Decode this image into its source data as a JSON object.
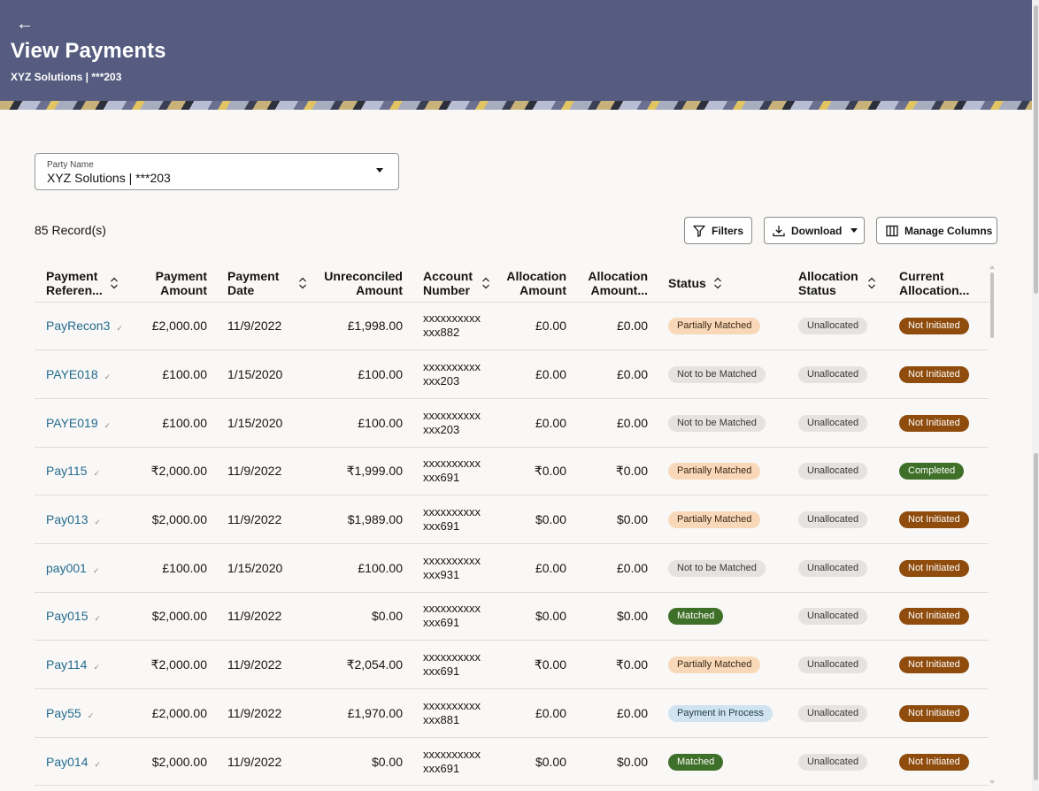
{
  "header": {
    "back_label": "←",
    "title": "View Payments",
    "subtitle": "XYZ Solutions | ***203"
  },
  "party": {
    "label": "Party Name",
    "value": "XYZ Solutions | ***203"
  },
  "records_label": "85 Record(s)",
  "toolbar": {
    "filters_label": "Filters",
    "download_label": "Download",
    "manage_columns_label": "Manage Columns"
  },
  "table": {
    "headers": {
      "payment_reference": [
        "Payment",
        "Referen..."
      ],
      "payment_amount": [
        "Payment",
        "Amount"
      ],
      "payment_date": [
        "Payment",
        "Date"
      ],
      "unreconciled_amount": [
        "Unreconciled",
        "Amount"
      ],
      "account_number": [
        "Account",
        "Number"
      ],
      "allocation_amount": [
        "Allocation",
        "Amount"
      ],
      "allocation_amount_2": [
        "Allocation",
        "Amount..."
      ],
      "status": [
        "Status"
      ],
      "allocation_status": [
        "Allocation",
        "Status"
      ],
      "current_allocation": [
        "Current",
        "Allocation..."
      ]
    },
    "rows": [
      {
        "ref": "PayRecon3",
        "payment_amount": "£2,000.00",
        "date": "11/9/2022",
        "unreconciled": "£1,998.00",
        "account_1": "xxxxxxxxxx",
        "account_2": "xxx882",
        "alloc_amount": "£0.00",
        "alloc_amount_2": "£0.00",
        "status": "Partially Matched",
        "alloc_status": "Unallocated",
        "current": "Not Initiated"
      },
      {
        "ref": "PAYE018",
        "payment_amount": "£100.00",
        "date": "1/15/2020",
        "unreconciled": "£100.00",
        "account_1": "xxxxxxxxxx",
        "account_2": "xxx203",
        "alloc_amount": "£0.00",
        "alloc_amount_2": "£0.00",
        "status": "Not to be Matched",
        "alloc_status": "Unallocated",
        "current": "Not Initiated"
      },
      {
        "ref": "PAYE019",
        "payment_amount": "£100.00",
        "date": "1/15/2020",
        "unreconciled": "£100.00",
        "account_1": "xxxxxxxxxx",
        "account_2": "xxx203",
        "alloc_amount": "£0.00",
        "alloc_amount_2": "£0.00",
        "status": "Not to be Matched",
        "alloc_status": "Unallocated",
        "current": "Not Initiated"
      },
      {
        "ref": "Pay115",
        "payment_amount": "₹2,000.00",
        "date": "11/9/2022",
        "unreconciled": "₹1,999.00",
        "account_1": "xxxxxxxxxx",
        "account_2": "xxx691",
        "alloc_amount": "₹0.00",
        "alloc_amount_2": "₹0.00",
        "status": "Partially Matched",
        "alloc_status": "Unallocated",
        "current": "Completed"
      },
      {
        "ref": "Pay013",
        "payment_amount": "$2,000.00",
        "date": "11/9/2022",
        "unreconciled": "$1,989.00",
        "account_1": "xxxxxxxxxx",
        "account_2": "xxx691",
        "alloc_amount": "$0.00",
        "alloc_amount_2": "$0.00",
        "status": "Partially Matched",
        "alloc_status": "Unallocated",
        "current": "Not Initiated"
      },
      {
        "ref": "pay001",
        "payment_amount": "£100.00",
        "date": "1/15/2020",
        "unreconciled": "£100.00",
        "account_1": "xxxxxxxxxx",
        "account_2": "xxx931",
        "alloc_amount": "£0.00",
        "alloc_amount_2": "£0.00",
        "status": "Not to be Matched",
        "alloc_status": "Unallocated",
        "current": "Not Initiated"
      },
      {
        "ref": "Pay015",
        "payment_amount": "$2,000.00",
        "date": "11/9/2022",
        "unreconciled": "$0.00",
        "account_1": "xxxxxxxxxx",
        "account_2": "xxx691",
        "alloc_amount": "$0.00",
        "alloc_amount_2": "$0.00",
        "status": "Matched",
        "alloc_status": "Unallocated",
        "current": "Not Initiated"
      },
      {
        "ref": "Pay114",
        "payment_amount": "₹2,000.00",
        "date": "11/9/2022",
        "unreconciled": "₹2,054.00",
        "account_1": "xxxxxxxxxx",
        "account_2": "xxx691",
        "alloc_amount": "₹0.00",
        "alloc_amount_2": "₹0.00",
        "status": "Partially Matched",
        "alloc_status": "Unallocated",
        "current": "Not Initiated"
      },
      {
        "ref": "Pay55",
        "payment_amount": "£2,000.00",
        "date": "11/9/2022",
        "unreconciled": "£1,970.00",
        "account_1": "xxxxxxxxxx",
        "account_2": "xxx881",
        "alloc_amount": "£0.00",
        "alloc_amount_2": "£0.00",
        "status": "Payment in Process",
        "alloc_status": "Unallocated",
        "current": "Not Initiated"
      },
      {
        "ref": "Pay014",
        "payment_amount": "$2,000.00",
        "date": "11/9/2022",
        "unreconciled": "$0.00",
        "account_1": "xxxxxxxxxx",
        "account_2": "xxx691",
        "alloc_amount": "$0.00",
        "alloc_amount_2": "$0.00",
        "status": "Matched",
        "alloc_status": "Unallocated",
        "current": "Not Initiated"
      }
    ]
  },
  "colors": {
    "header_bg": "#555c7f",
    "link": "#236a8e",
    "partially_matched_bg": "#f8d8b8",
    "matched_bg": "#3f7029",
    "not_initiated_bg": "#8f4c0d",
    "payment_in_process_bg": "#d0e3ef"
  }
}
